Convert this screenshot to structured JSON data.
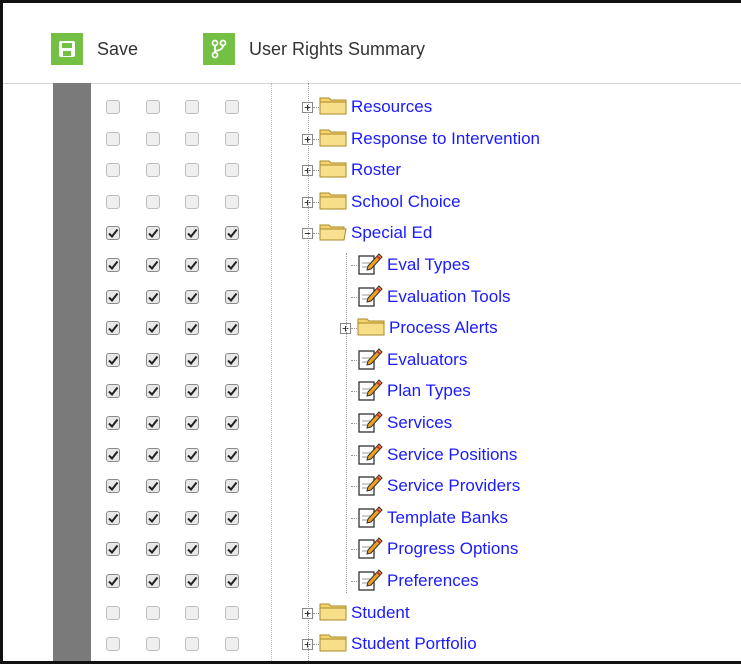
{
  "toolbar": {
    "save_label": "Save",
    "summary_label": "User Rights Summary",
    "accent": "#74c044"
  },
  "rows": [
    {
      "label": "Resources",
      "kind": "folder",
      "expander": "+",
      "checked": false,
      "level": 0
    },
    {
      "label": "Response to Intervention",
      "kind": "folder",
      "expander": "+",
      "checked": false,
      "level": 0
    },
    {
      "label": "Roster",
      "kind": "folder",
      "expander": "+",
      "checked": false,
      "level": 0
    },
    {
      "label": "School Choice",
      "kind": "folder",
      "expander": "+",
      "checked": false,
      "level": 0
    },
    {
      "label": "Special Ed",
      "kind": "folder-open",
      "expander": "−",
      "checked": true,
      "level": 0
    },
    {
      "label": "Eval Types",
      "kind": "tool",
      "expander": "",
      "checked": true,
      "level": 1
    },
    {
      "label": "Evaluation Tools",
      "kind": "tool",
      "expander": "",
      "checked": true,
      "level": 1
    },
    {
      "label": "Process Alerts",
      "kind": "folder",
      "expander": "+",
      "checked": true,
      "level": 1
    },
    {
      "label": "Evaluators",
      "kind": "tool",
      "expander": "",
      "checked": true,
      "level": 1
    },
    {
      "label": "Plan Types",
      "kind": "tool",
      "expander": "",
      "checked": true,
      "level": 1
    },
    {
      "label": "Services",
      "kind": "tool",
      "expander": "",
      "checked": true,
      "level": 1
    },
    {
      "label": "Service Positions",
      "kind": "tool",
      "expander": "",
      "checked": true,
      "level": 1
    },
    {
      "label": "Service Providers",
      "kind": "tool",
      "expander": "",
      "checked": true,
      "level": 1
    },
    {
      "label": "Template Banks",
      "kind": "tool",
      "expander": "",
      "checked": true,
      "level": 1
    },
    {
      "label": "Progress Options",
      "kind": "tool",
      "expander": "",
      "checked": true,
      "level": 1
    },
    {
      "label": "Preferences",
      "kind": "tool",
      "expander": "",
      "checked": true,
      "level": 1
    },
    {
      "label": "Student",
      "kind": "folder",
      "expander": "+",
      "checked": false,
      "level": 0
    },
    {
      "label": "Student Portfolio",
      "kind": "folder",
      "expander": "+",
      "checked": false,
      "level": 0
    }
  ]
}
